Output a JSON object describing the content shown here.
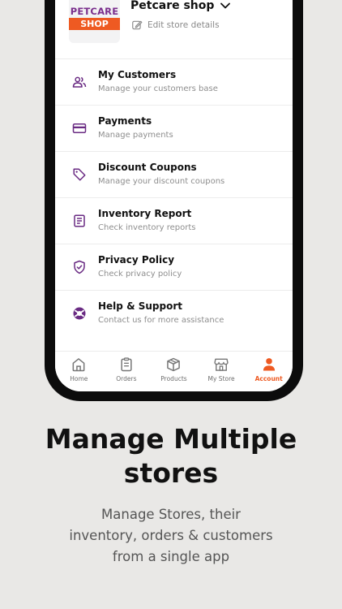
{
  "store": {
    "logo_top": "PETCARE",
    "logo_bottom": "SHOP",
    "name": "Petcare shop",
    "edit_label": "Edit store details"
  },
  "menu": [
    {
      "title": "My Customers",
      "subtitle": "Manage your customers base",
      "icon": "users-icon"
    },
    {
      "title": "Payments",
      "subtitle": "Manage payments",
      "icon": "credit-card-icon"
    },
    {
      "title": "Discount Coupons",
      "subtitle": "Manage your discount coupons",
      "icon": "tag-icon"
    },
    {
      "title": "Inventory Report",
      "subtitle": "Check inventory reports",
      "icon": "report-icon"
    },
    {
      "title": "Privacy Policy",
      "subtitle": "Check privacy policy",
      "icon": "shield-check-icon"
    },
    {
      "title": "Help & Support",
      "subtitle": "Contact us for more assistance",
      "icon": "lifebuoy-icon"
    }
  ],
  "nav": [
    {
      "label": "Home",
      "icon": "home-icon",
      "active": false
    },
    {
      "label": "Orders",
      "icon": "orders-icon",
      "active": false
    },
    {
      "label": "Products",
      "icon": "box-icon",
      "active": false
    },
    {
      "label": "My Store",
      "icon": "store-icon",
      "active": false
    },
    {
      "label": "Account",
      "icon": "user-icon",
      "active": true
    }
  ],
  "promo": {
    "headline_line1": "Manage Multiple",
    "headline_line2": "stores",
    "sub_line1": "Manage Stores, their",
    "sub_line2": "inventory, orders & customers",
    "sub_line3": "from a single app"
  },
  "colors": {
    "accent": "#ee5a22",
    "icon_purple": "#6a2b83",
    "background": "#e9e8e6"
  }
}
